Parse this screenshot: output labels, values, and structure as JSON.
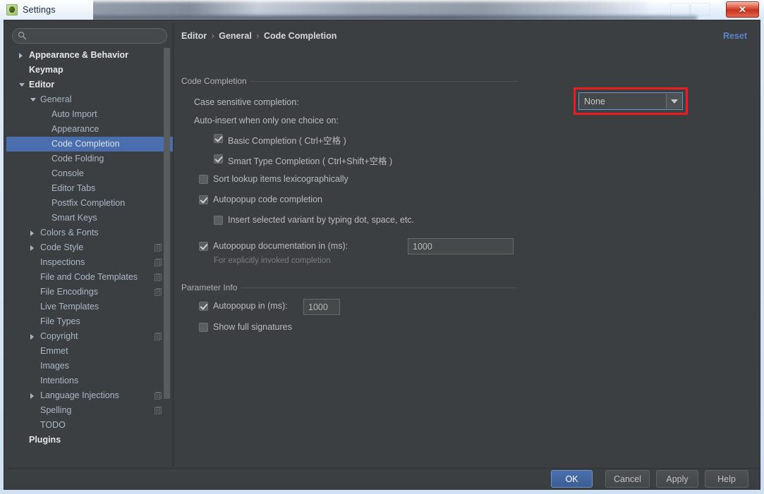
{
  "window": {
    "title": "Settings",
    "app_icon": "android-studio-icon",
    "close_label": "✕"
  },
  "sidebar": {
    "search": {
      "value": "",
      "placeholder": ""
    },
    "items": [
      {
        "label": "Appearance & Behavior",
        "depth": 0,
        "twisty": "right",
        "bold": true,
        "selected": false,
        "scope_icon": false
      },
      {
        "label": "Keymap",
        "depth": 0,
        "twisty": "none",
        "bold": true,
        "selected": false,
        "scope_icon": false
      },
      {
        "label": "Editor",
        "depth": 0,
        "twisty": "down",
        "bold": true,
        "selected": false,
        "scope_icon": false
      },
      {
        "label": "General",
        "depth": 1,
        "twisty": "down",
        "bold": false,
        "selected": false,
        "scope_icon": false
      },
      {
        "label": "Auto Import",
        "depth": 2,
        "twisty": "none",
        "bold": false,
        "selected": false,
        "scope_icon": false
      },
      {
        "label": "Appearance",
        "depth": 2,
        "twisty": "none",
        "bold": false,
        "selected": false,
        "scope_icon": false
      },
      {
        "label": "Code Completion",
        "depth": 2,
        "twisty": "none",
        "bold": false,
        "selected": true,
        "scope_icon": false
      },
      {
        "label": "Code Folding",
        "depth": 2,
        "twisty": "none",
        "bold": false,
        "selected": false,
        "scope_icon": false
      },
      {
        "label": "Console",
        "depth": 2,
        "twisty": "none",
        "bold": false,
        "selected": false,
        "scope_icon": false
      },
      {
        "label": "Editor Tabs",
        "depth": 2,
        "twisty": "none",
        "bold": false,
        "selected": false,
        "scope_icon": false
      },
      {
        "label": "Postfix Completion",
        "depth": 2,
        "twisty": "none",
        "bold": false,
        "selected": false,
        "scope_icon": false
      },
      {
        "label": "Smart Keys",
        "depth": 2,
        "twisty": "none",
        "bold": false,
        "selected": false,
        "scope_icon": false
      },
      {
        "label": "Colors & Fonts",
        "depth": 1,
        "twisty": "right",
        "bold": false,
        "selected": false,
        "scope_icon": false
      },
      {
        "label": "Code Style",
        "depth": 1,
        "twisty": "right",
        "bold": false,
        "selected": false,
        "scope_icon": true
      },
      {
        "label": "Inspections",
        "depth": 1,
        "twisty": "none",
        "bold": false,
        "selected": false,
        "scope_icon": true
      },
      {
        "label": "File and Code Templates",
        "depth": 1,
        "twisty": "none",
        "bold": false,
        "selected": false,
        "scope_icon": true
      },
      {
        "label": "File Encodings",
        "depth": 1,
        "twisty": "none",
        "bold": false,
        "selected": false,
        "scope_icon": true
      },
      {
        "label": "Live Templates",
        "depth": 1,
        "twisty": "none",
        "bold": false,
        "selected": false,
        "scope_icon": false
      },
      {
        "label": "File Types",
        "depth": 1,
        "twisty": "none",
        "bold": false,
        "selected": false,
        "scope_icon": false
      },
      {
        "label": "Copyright",
        "depth": 1,
        "twisty": "right",
        "bold": false,
        "selected": false,
        "scope_icon": true
      },
      {
        "label": "Emmet",
        "depth": 1,
        "twisty": "none",
        "bold": false,
        "selected": false,
        "scope_icon": false
      },
      {
        "label": "Images",
        "depth": 1,
        "twisty": "none",
        "bold": false,
        "selected": false,
        "scope_icon": false
      },
      {
        "label": "Intentions",
        "depth": 1,
        "twisty": "none",
        "bold": false,
        "selected": false,
        "scope_icon": false
      },
      {
        "label": "Language Injections",
        "depth": 1,
        "twisty": "right",
        "bold": false,
        "selected": false,
        "scope_icon": true
      },
      {
        "label": "Spelling",
        "depth": 1,
        "twisty": "none",
        "bold": false,
        "selected": false,
        "scope_icon": true
      },
      {
        "label": "TODO",
        "depth": 1,
        "twisty": "none",
        "bold": false,
        "selected": false,
        "scope_icon": false
      },
      {
        "label": "Plugins",
        "depth": 0,
        "twisty": "none",
        "bold": true,
        "selected": false,
        "scope_icon": false
      }
    ]
  },
  "main": {
    "breadcrumb": {
      "part1": "Editor",
      "part2": "General",
      "part3": "Code Completion",
      "separator": "›"
    },
    "reset_label": "Reset",
    "group_code_completion": {
      "title": "Code Completion",
      "case_sensitive_label": "Case sensitive completion:",
      "case_sensitive_value": "None",
      "auto_insert_label": "Auto-insert when only one choice on:",
      "checkboxes": [
        {
          "label": "Basic Completion ( Ctrl+空格 )",
          "checked": true,
          "indent": 2
        },
        {
          "label": "Smart Type Completion ( Ctrl+Shift+空格 )",
          "checked": true,
          "indent": 2
        },
        {
          "label": "Sort lookup items lexicographically",
          "checked": false,
          "indent": 1
        },
        {
          "label": "Autopopup code completion",
          "checked": true,
          "indent": 1
        },
        {
          "label": "Insert selected variant by typing dot, space, etc.",
          "checked": false,
          "indent": 2
        },
        {
          "label": "Autopopup documentation in (ms):",
          "checked": true,
          "indent": 1
        }
      ],
      "autopopup_doc_value": "1000",
      "autopopup_doc_hint": "For explicitly invoked completion"
    },
    "group_parameter_info": {
      "title": "Parameter Info",
      "autopopup_label": "Autopopup in (ms):",
      "autopopup_value": "1000",
      "autopopup_checked": true,
      "show_full_signatures_label": "Show full signatures",
      "show_full_signatures_checked": false
    }
  },
  "footer": {
    "ok": "OK",
    "cancel": "Cancel",
    "apply": "Apply",
    "help": "Help"
  },
  "colors": {
    "panel_bg": "#3c3f41",
    "selection": "#4b6eaf",
    "accent_link": "#5c83c9",
    "highlight_box": "#ee1c1c",
    "text": "#bbbbbb"
  }
}
